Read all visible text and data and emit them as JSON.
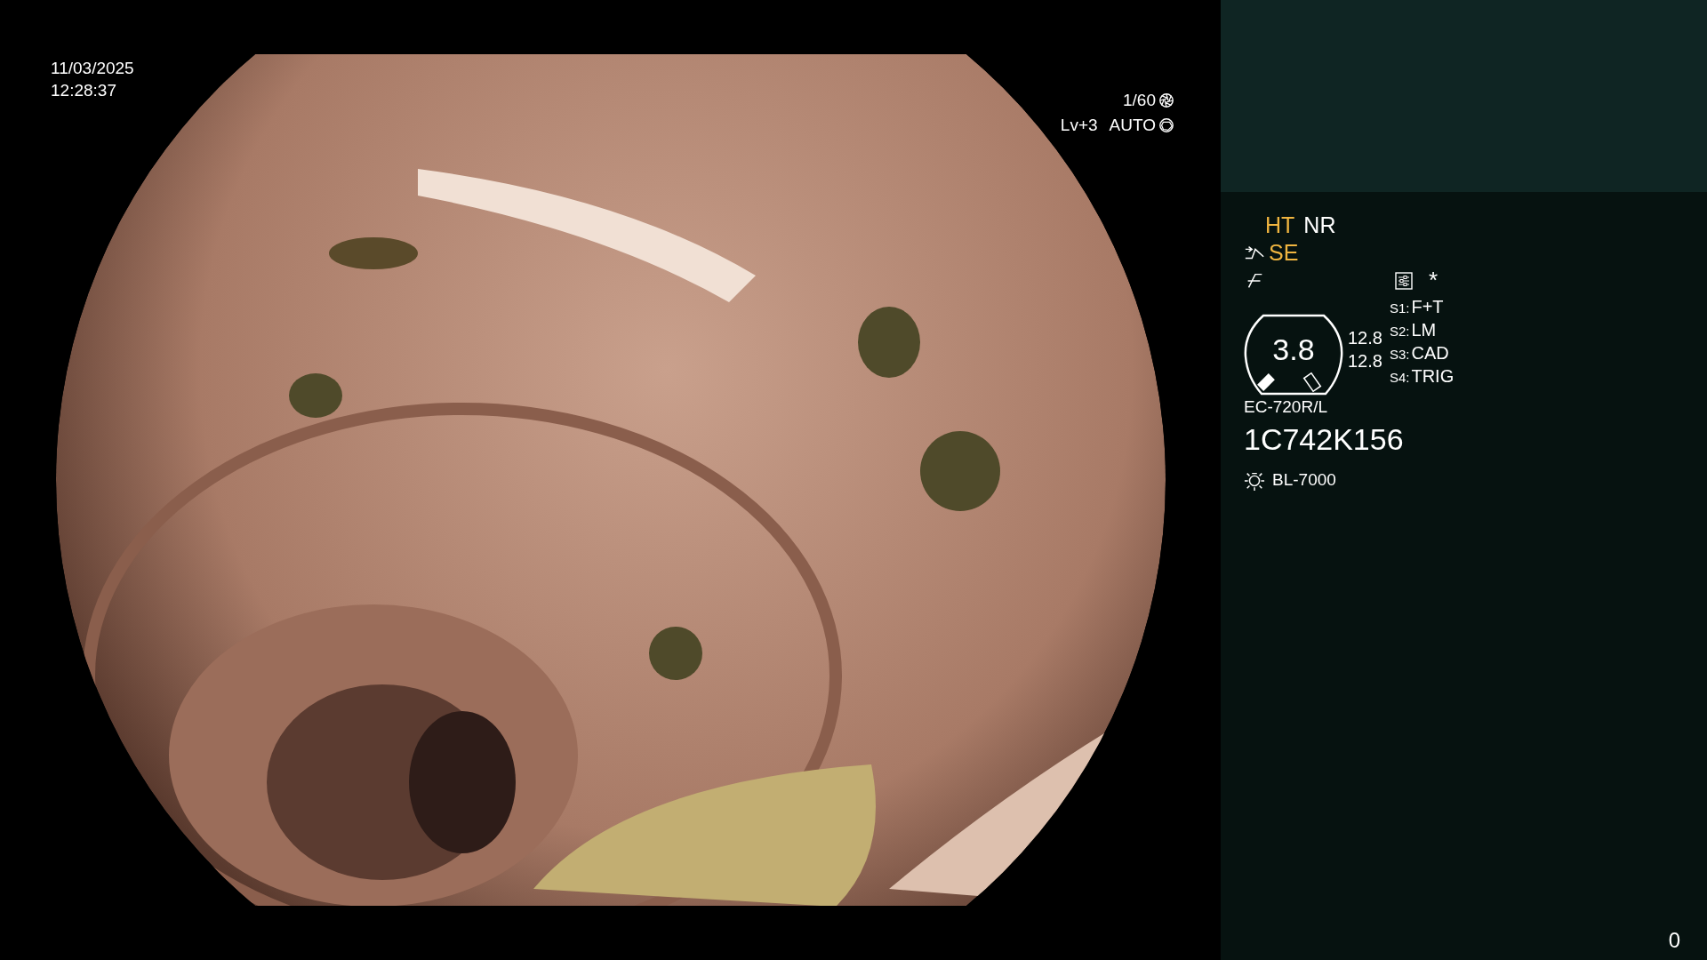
{
  "video": {
    "date": "11/03/2025",
    "time": "12:28:37",
    "shutter": "1/60",
    "exposure_level": "Lv+3",
    "exposure_mode": "AUTO"
  },
  "panel": {
    "modes": [
      {
        "label": "HT",
        "color": "#f0b540"
      },
      {
        "label": "NR",
        "color": "#ffffff"
      }
    ],
    "enhancement": {
      "label": "SE",
      "color": "#f0b540"
    },
    "asterisk": "*",
    "scope_gauge": {
      "value": "3.8",
      "readings": [
        "12.8",
        "12.8"
      ]
    },
    "switches": [
      {
        "key": "S1:",
        "value": "F+T"
      },
      {
        "key": "S2:",
        "value": "LM"
      },
      {
        "key": "S3:",
        "value": "CAD"
      },
      {
        "key": "S4:",
        "value": "TRIG"
      }
    ],
    "scope_model": "EC-720R/L",
    "scope_serial": "1C742K156",
    "light_source": "BL-7000"
  },
  "counter": "0"
}
